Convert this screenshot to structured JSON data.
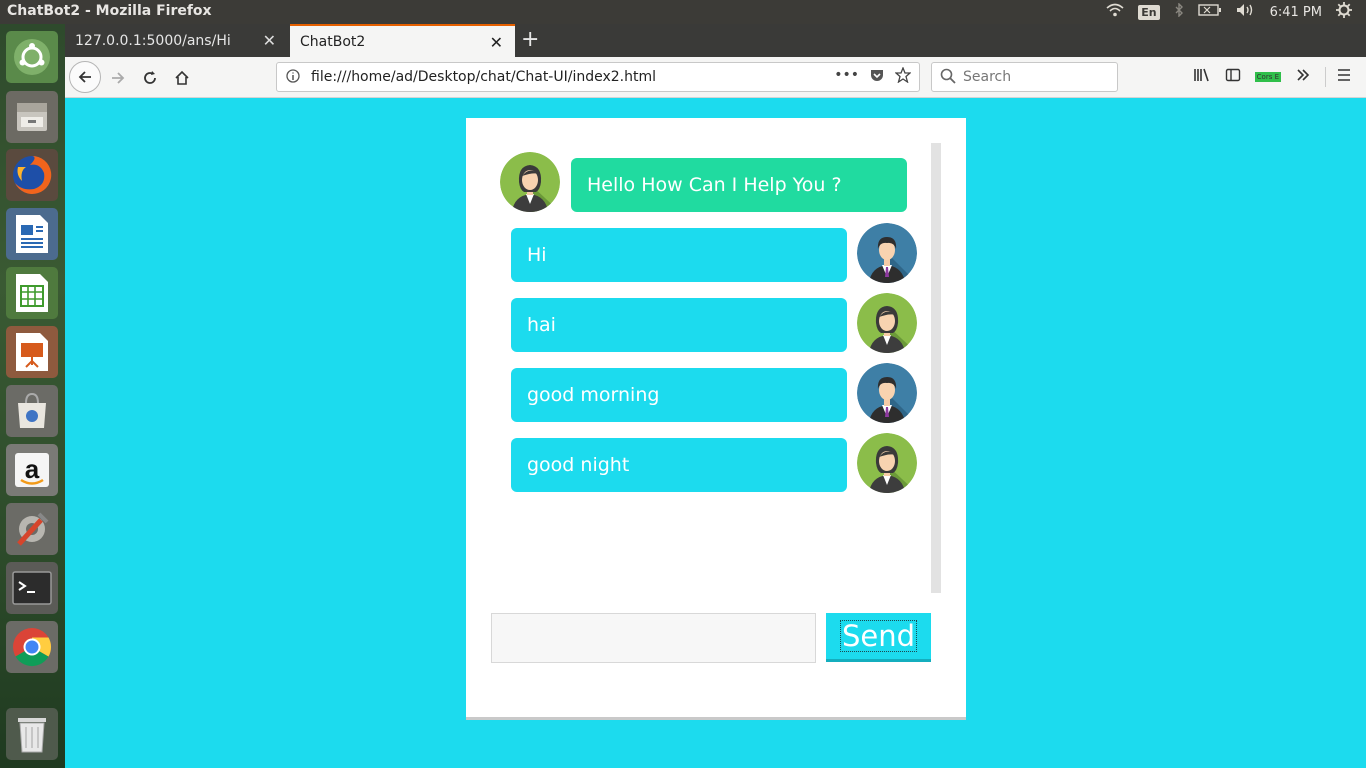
{
  "topbar": {
    "window_title": "ChatBot2 - Mozilla Firefox",
    "keyboard": "En",
    "clock": "6:41 PM"
  },
  "launcher": {
    "items": [
      "ubuntu-dash",
      "files",
      "firefox",
      "writer",
      "calc",
      "impress",
      "software-center",
      "amazon",
      "system-settings",
      "terminal",
      "chrome",
      "trash"
    ]
  },
  "browser": {
    "tabs": [
      {
        "label": "127.0.0.1:5000/ans/Hi",
        "active": false
      },
      {
        "label": "ChatBot2",
        "active": true
      }
    ],
    "url": "file:///home/ad/Desktop/chat/Chat-UI/index2.html",
    "search_placeholder": "Search",
    "cors_label": "Cors E"
  },
  "chat": {
    "messages": [
      {
        "from": "bot",
        "text": "Hello How Can I Help You ?",
        "avatar": "female"
      },
      {
        "from": "user",
        "text": "Hi",
        "avatar": "male"
      },
      {
        "from": "user",
        "text": "hai",
        "avatar": "female"
      },
      {
        "from": "user",
        "text": "good morning",
        "avatar": "male"
      },
      {
        "from": "user",
        "text": "good night",
        "avatar": "female"
      }
    ],
    "input_value": "",
    "send_label": "Send"
  },
  "colors": {
    "page_bg": "#1cdbee",
    "bot_bubble": "#20dba0",
    "user_bubble": "#1cdbee"
  }
}
